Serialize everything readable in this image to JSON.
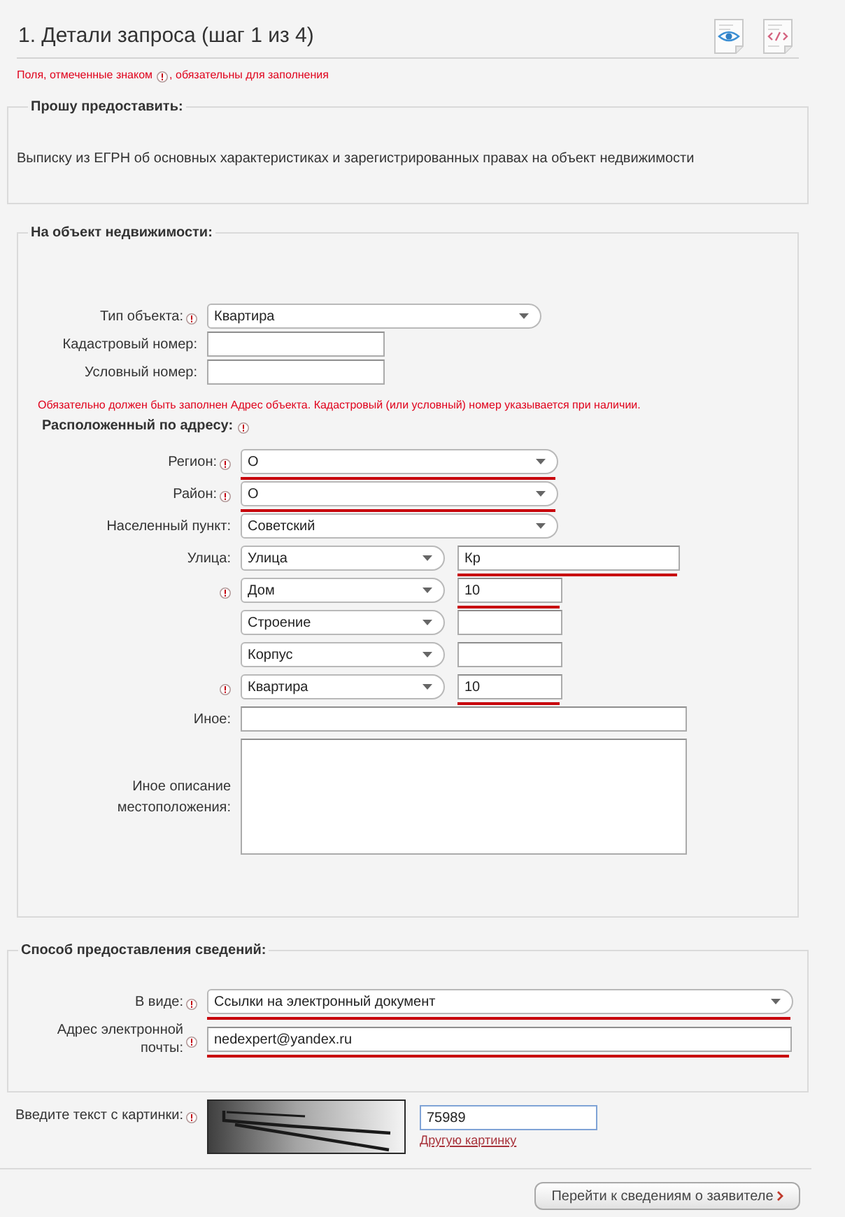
{
  "header": {
    "title": "1. Детали запроса (шаг 1 из 4)"
  },
  "required_note": {
    "before": "Поля, отмеченные знаком",
    "after": ", обязательны для заполнения"
  },
  "request": {
    "legend": "Прошу предоставить:",
    "text": "Выписку из ЕГРН об основных характеристиках и зарегистрированных правах на объект недвижимости"
  },
  "object": {
    "legend": "На объект недвижимости:",
    "fields": [
      {
        "label": "Тип объекта:",
        "required": true,
        "kind": "select",
        "value": "Квартира",
        "highlighted": false
      },
      {
        "label": "Кадастровый номер:",
        "required": false,
        "kind": "text",
        "highlighted": false
      },
      {
        "label": "Условный номер:",
        "required": false,
        "kind": "text",
        "highlighted": false
      }
    ],
    "address_note": "Обязательно должен быть заполнен Адрес объекта. Кадастровый (или условный) номер указывается при наличии.",
    "address_heading": "Расположенный по адресу:",
    "address_heading_required": true,
    "address_fields": [
      {
        "label": "Регион:",
        "required": true,
        "kind": "select",
        "value": "О",
        "highlighted": true
      },
      {
        "label": "Район:",
        "required": true,
        "kind": "select",
        "value": "О",
        "highlighted": true
      },
      {
        "label": "Населенный пункт:",
        "required": false,
        "kind": "select",
        "value": "Советский",
        "highlighted": false
      },
      {
        "label": "Улица:",
        "required": false,
        "kind": "street",
        "value": "Улица",
        "text_value": "Кр",
        "highlighted": true
      },
      {
        "required": true,
        "kind": "number",
        "value": "Дом",
        "text_value": "10",
        "highlighted": true
      },
      {
        "required": false,
        "kind": "number",
        "value": "Строение",
        "highlighted": false
      },
      {
        "required": false,
        "kind": "number",
        "value": "Корпус",
        "highlighted": false
      },
      {
        "required": true,
        "kind": "number",
        "value": "Квартира",
        "text_value": "10",
        "highlighted": true
      },
      {
        "label": "Иное:",
        "required": false,
        "kind": "text",
        "highlighted": false
      },
      {
        "label": "Иное описание местоположения:",
        "required": false,
        "kind": "textarea",
        "highlighted": false
      }
    ]
  },
  "delivery": {
    "legend": "Способ предоставления сведений:",
    "fields": [
      {
        "label": "В виде:",
        "required": true,
        "kind": "select",
        "value": "Ссылки на электронный документ",
        "highlighted": true
      },
      {
        "label": "Адрес электронной почты:",
        "required": true,
        "kind": "text",
        "value": "nedexpert@yandex.ru",
        "highlighted": true
      }
    ]
  },
  "captcha": {
    "label": "Введите текст с картинки:",
    "required": true,
    "value": "75989",
    "refresh_link": "Другую картинку"
  },
  "next_button": "Перейти к сведениям о заявителе"
}
